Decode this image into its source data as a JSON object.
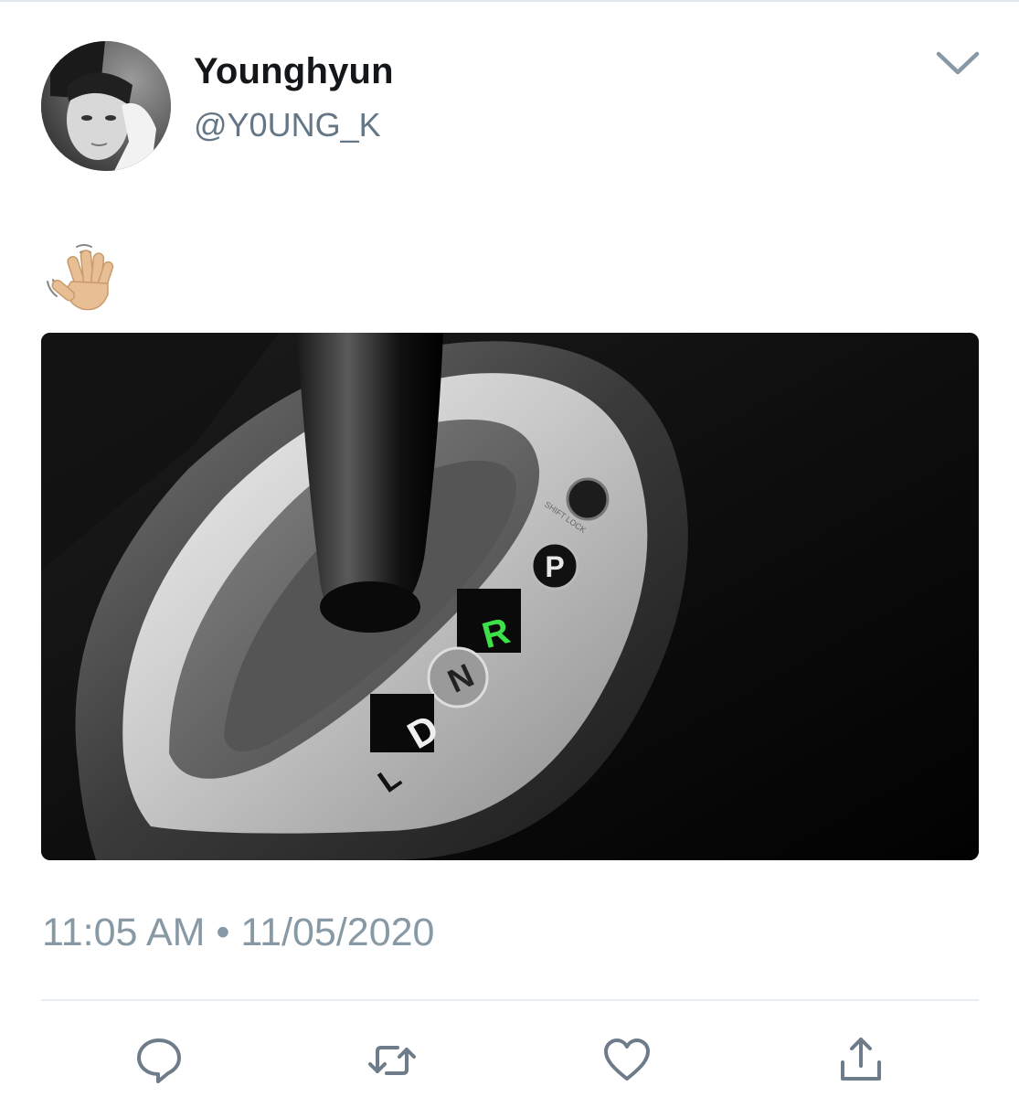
{
  "tweet": {
    "author": {
      "display_name": "Younghyun",
      "handle": "@Y0UNG_K"
    },
    "text": "👋🏼",
    "media": {
      "gear_labels": [
        "P",
        "R",
        "N",
        "D",
        "L"
      ],
      "button_label": "SHIFT LOCK"
    },
    "timestamp": "11:05 AM • 11/05/2020"
  },
  "icons": {
    "menu": "chevron-down-icon",
    "reply": "reply-icon",
    "retweet": "retweet-icon",
    "like": "heart-icon",
    "share": "share-icon"
  },
  "colors": {
    "text": "#14171a",
    "secondary": "#657786",
    "timestamp": "#8899a6",
    "icon": "#6e7b89",
    "divider": "#e6ecf0",
    "gear_highlight": "#3ee04a"
  }
}
